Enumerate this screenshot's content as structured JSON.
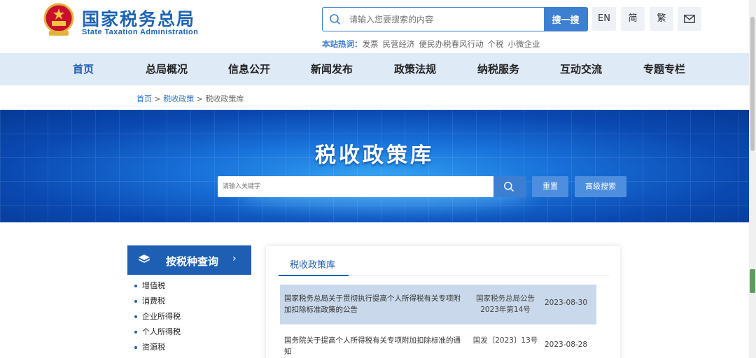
{
  "header": {
    "logo_cn": "国家税务总局",
    "logo_en": "State Taxation Administration",
    "search_placeholder": "请输入您要搜索的内容",
    "search_button": "搜一搜",
    "lang_en": "EN",
    "lang_simplified": "简",
    "lang_traditional": "繁",
    "hot_label": "本站热词：",
    "hot_words": [
      "发票",
      "民营经济",
      "便民办税春风行动",
      "个税",
      "小微企业"
    ]
  },
  "nav": {
    "items": [
      "首页",
      "总局概况",
      "信息公开",
      "新闻发布",
      "政策法规",
      "纳税服务",
      "互动交流",
      "专题专栏"
    ]
  },
  "breadcrumb": {
    "home": "首页",
    "sep": ">",
    "section": "税收政策",
    "current": "税收政策库"
  },
  "banner": {
    "title": "税收政策库",
    "search_placeholder": "请输入关键字",
    "reset_label": "重置",
    "advanced_label": "高级搜索"
  },
  "sidebar": {
    "title": "按税种查询",
    "items": [
      "增值税",
      "消费税",
      "企业所得税",
      "个人所得税",
      "资源税"
    ]
  },
  "panel": {
    "tab_label": "税收政策库",
    "rows": [
      {
        "title": "国家税务总局关于贯彻执行提高个人所得税有关专项附加扣除标准政策的公告",
        "doc_no": "国家税务总局公告2023年第14号",
        "date": "2023-08-30"
      },
      {
        "title": "国务院关于提高个人所得税有关专项附加扣除标准的通知",
        "doc_no": "国发〔2023〕13号",
        "date": "2023-08-28"
      }
    ]
  },
  "colors": {
    "brand_blue": "#1e5fb4",
    "nav_bg": "#dfeaf7",
    "row_highlight": "#c9d8ea"
  }
}
